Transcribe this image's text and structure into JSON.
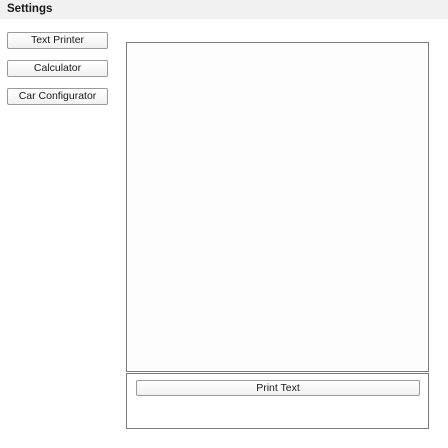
{
  "menu": {
    "settings_label": "Settings"
  },
  "nav": {
    "items": [
      {
        "label": "Text Printer"
      },
      {
        "label": "Calculator"
      },
      {
        "label": "Car Configurator"
      }
    ]
  },
  "main": {
    "output_text": "",
    "print_button_label": "Print Text"
  }
}
